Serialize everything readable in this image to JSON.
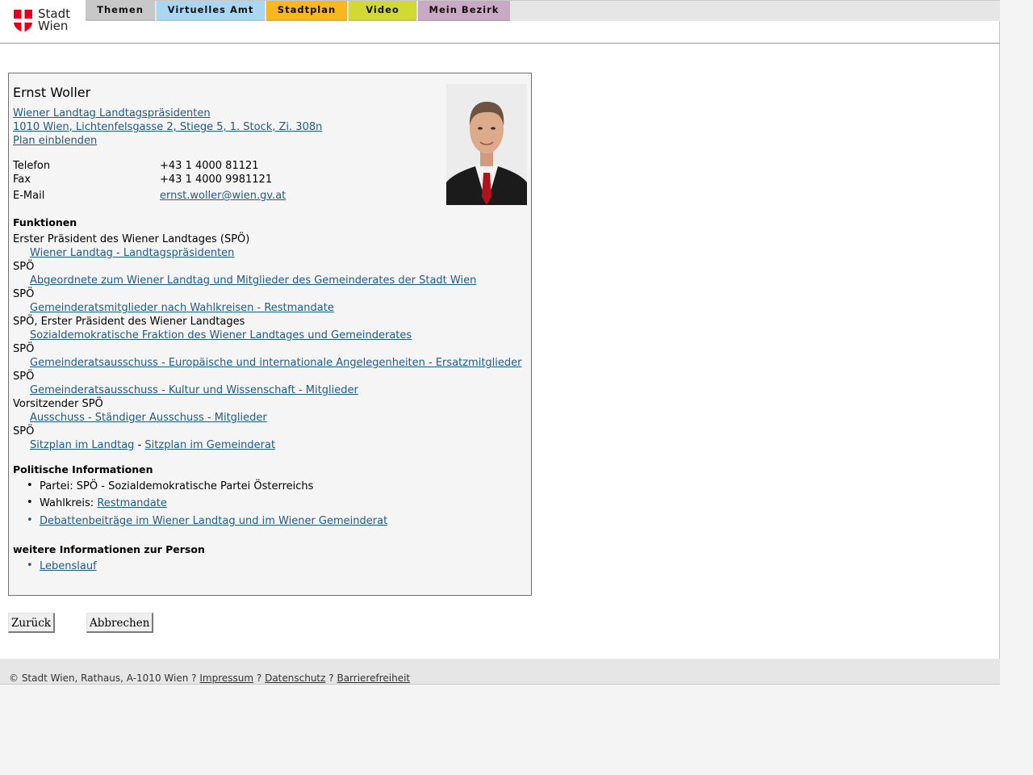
{
  "header": {
    "logo_line1": "Stadt",
    "logo_line2": "Wien",
    "tabs": [
      {
        "label": "Themen",
        "color": "#c8c8c8"
      },
      {
        "label": "Virtuelles Amt",
        "color": "#a9d7f3"
      },
      {
        "label": "Stadtplan",
        "color": "#f7b71d"
      },
      {
        "label": "Video",
        "color": "#d2d935"
      },
      {
        "label": "Mein Bezirk",
        "color": "#c9a9c3"
      }
    ]
  },
  "person": {
    "name": "Ernst Woller",
    "org_link": "Wiener Landtag Landtagspräsidenten",
    "address_link": "1010 Wien, Lichtenfelsgasse 2, Stiege 5, 1. Stock, Zi. 308n",
    "plan_link": "Plan einblenden",
    "phone_label": "Telefon",
    "phone": "+43 1 4000 81121",
    "fax_label": "Fax",
    "fax": "+43 1 4000 9981121",
    "email_label": "E-Mail",
    "email": "ernst.woller@wien.gv.at"
  },
  "functions": {
    "title": "Funktionen",
    "items": [
      {
        "role": "Erster Präsident des Wiener Landtages (SPÖ)",
        "link": "Wiener Landtag - Landtagspräsidenten"
      },
      {
        "role": "SPÖ",
        "link": "Abgeordnete zum Wiener Landtag und Mitglieder des Gemeinderates der Stadt Wien"
      },
      {
        "role": "SPÖ",
        "link": "Gemeinderatsmitglieder nach Wahlkreisen - Restmandate"
      },
      {
        "role": "SPÖ, Erster Präsident des Wiener Landtages",
        "link": "Sozialdemokratische Fraktion des Wiener Landtages und Gemeinderates"
      },
      {
        "role": "SPÖ",
        "link": "Gemeinderatsausschuss - Europäische und internationale Angelegenheiten - Ersatzmitglieder"
      },
      {
        "role": "SPÖ",
        "link": "Gemeinderatsausschuss - Kultur und Wissenschaft - Mitglieder"
      },
      {
        "role": "Vorsitzender SPÖ",
        "link": "Ausschuss - Ständiger Ausschuss - Mitglieder"
      },
      {
        "role": "SPÖ",
        "link": ""
      }
    ],
    "seat_link_1": "Sitzplan im Landtag",
    "seat_separator": "-",
    "seat_link_2": "Sitzplan im Gemeinderat"
  },
  "political": {
    "title": "Politische Informationen",
    "party": "Partei: SPÖ - Sozialdemokratische Partei Österreichs",
    "constituency_label": "Wahlkreis:",
    "constituency_link": "Restmandate",
    "debates_link": "Debattenbeiträge im Wiener Landtag und im Wiener Gemeinderat"
  },
  "more": {
    "title": "weitere Informationen zur Person",
    "cv_link": "Lebenslauf"
  },
  "buttons": {
    "back": "Zurück",
    "cancel": "Abbrechen"
  },
  "footer": {
    "copyright": "© Stadt Wien, Rathaus, A-1010 Wien",
    "sep": "?",
    "impressum": "Impressum",
    "datenschutz": "Datenschutz",
    "barrierefreiheit": "Barrierefreiheit"
  },
  "colors": {
    "link": "#1e5a8a",
    "logo_red": "#e2001a"
  }
}
